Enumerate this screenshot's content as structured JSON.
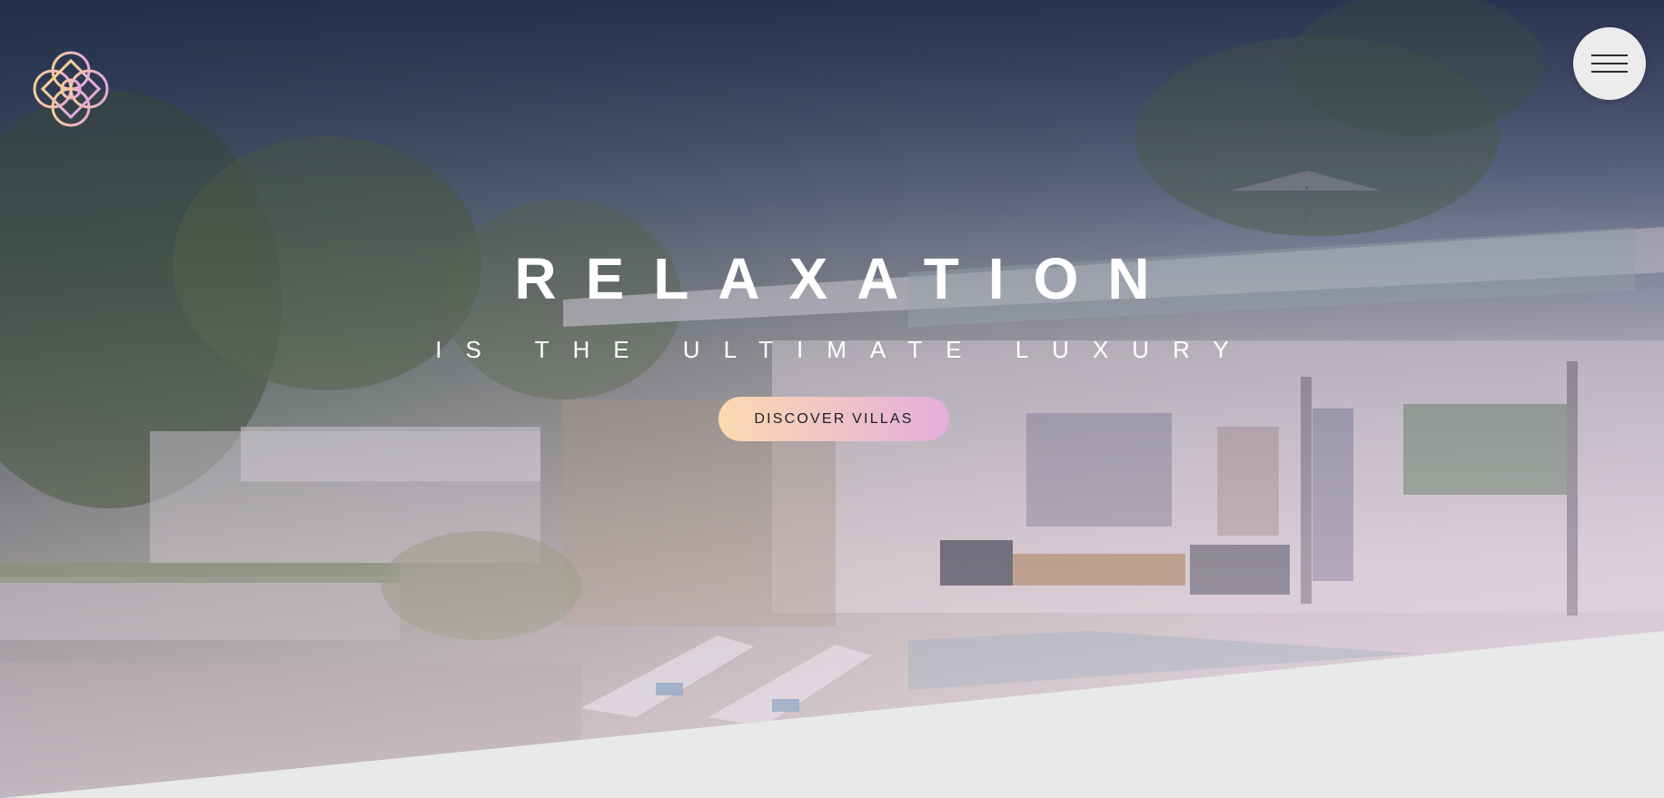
{
  "header": {
    "logo_icon": "lotus-logo-icon",
    "menu_icon": "hamburger-menu-icon"
  },
  "hero": {
    "title": "RELAXATION",
    "subtitle": "IS THE ULTIMATE LUXURY",
    "cta_label": "DISCOVER VILLAS"
  },
  "colors": {
    "cta_gradient_start": "#fbdab0",
    "cta_gradient_end": "#e3aedc",
    "logo_gradient_start": "#f6cf93",
    "logo_gradient_end": "#e6a8de",
    "menu_button_bg": "#ececec",
    "below_fold_bg": "#e9e9ea"
  }
}
